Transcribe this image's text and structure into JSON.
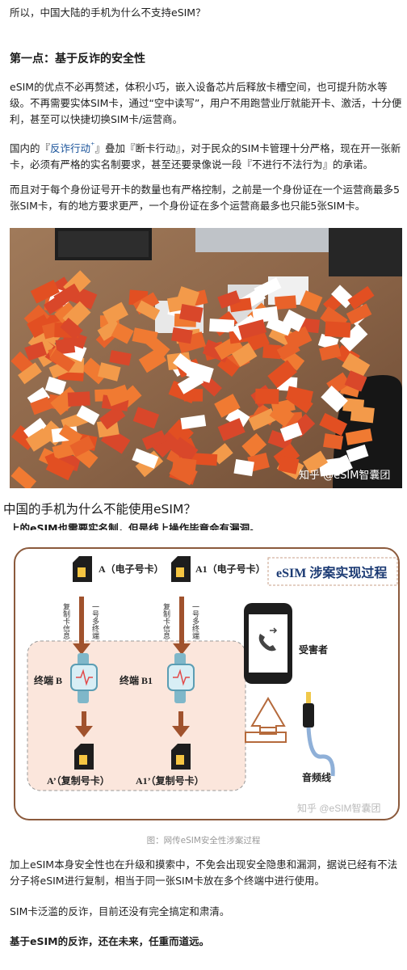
{
  "intro": "所以，中国大陆的手机为什么不支持eSIM？",
  "section_title": "第一点：基于反诈的安全性",
  "para1": "eSIM的优点不必再赘述，体积小巧，嵌入设备芯片后释放卡槽空间，也可提升防水等级。不再需要实体SIM卡，通过“空中读写”，用户不用跑营业厅就能开卡、激活，十分便利，甚至可以快捷切换SIM卡/运营商。",
  "para2": {
    "before": "国内的『",
    "link": "反诈行动",
    "link_mark": "⁺",
    "after": "』叠加『断卡行动』，对于民众的SIM卡管理十分严格，现在开一张新卡，必须有严格的实名制要求，甚至还要录像说一段『不进行不法行为』的承诺。"
  },
  "para3": "而且对于每个身份证号开卡的数量也有严格控制，之前是一个身份证在一个运营商最多5张SIM卡，有的地方要求更严，一个身份证在多个运营商最多也只能5张SIM卡。",
  "photo": {
    "watermark": "知乎 @eSIM智囊团"
  },
  "embedded_title": "中国的手机为什么不能使用eSIM？",
  "embedded_cut_line": "上的eSIM也需要实名制，但是线上操作毕竟会有漏洞。",
  "diagram": {
    "title": "eSIM 涉案实现过程",
    "card_a": "A（电子号卡）",
    "card_a1": "A1（电子号卡）",
    "arrow_left": "复制卡信息",
    "arrow_mid": "一号多终端",
    "arrow_right_1": "复制卡信息",
    "arrow_right_2": "一号多终端",
    "terminal_b": "终端 B",
    "terminal_b1": "终端 B1",
    "copy_a": "A’（复制号卡）",
    "copy_a1": "A1’（复制号卡）",
    "victim": "受害者",
    "audio": "音频线",
    "watermark": "知乎 @eSIM智囊团",
    "accent": "#e88a1a",
    "brand_color": "#1b3a73"
  },
  "caption": "图：网传eSIM安全性涉案过程",
  "para4": "加上eSIM本身安全性也在升级和摸索中，不免会出现安全隐患和漏洞，据说已经有不法分子将eSIM进行复制，相当于同一张SIM卡放在多个终端中进行使用。",
  "para5": "SIM卡泛滥的反诈，目前还没有完全搞定和肃清。",
  "para6": "基于eSIM的反诈，还在未来，任重而道远。"
}
